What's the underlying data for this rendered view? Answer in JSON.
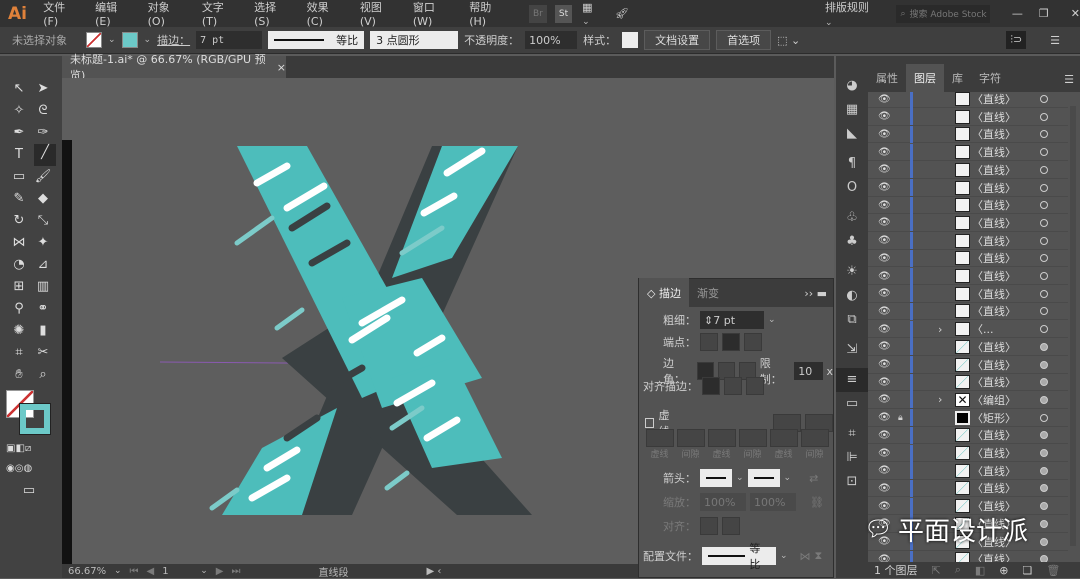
{
  "app": {
    "logo": "Ai",
    "menus": [
      "文件(F)",
      "编辑(E)",
      "对象(O)",
      "文字(T)",
      "选择(S)",
      "效果(C)",
      "视图(V)",
      "窗口(W)",
      "帮助(H)"
    ],
    "bridge": "Br",
    "stock": "St",
    "workspace": "排版规则",
    "search_placeholder": "搜索 Adobe Stock"
  },
  "control": {
    "selection": "未选择对象",
    "stroke_label": "描边：",
    "stroke_weight": "7 pt",
    "profile": "等比",
    "brush": "3 点圆形",
    "opacity_label": "不透明度：",
    "opacity": "100%",
    "style_label": "样式：",
    "doc_setup": "文档设置",
    "preferences": "首选项"
  },
  "document": {
    "tab": "未标题-1.ai* @ 66.67% (RGB/GPU 预览)",
    "close": "×"
  },
  "status": {
    "zoom": "66.67%",
    "artboard": "1",
    "tool": "直线段"
  },
  "layers": {
    "tabs": [
      "属性",
      "图层",
      "库",
      "字符"
    ],
    "active_tab": "图层",
    "footer": "1 个图层",
    "rows": [
      {
        "name": "〈直线〉",
        "t": 0
      },
      {
        "name": "〈直线〉",
        "t": 0
      },
      {
        "name": "〈直线〉",
        "t": 0
      },
      {
        "name": "〈直线〉",
        "t": 0
      },
      {
        "name": "〈直线〉",
        "t": 0
      },
      {
        "name": "〈直线〉",
        "t": 0
      },
      {
        "name": "〈直线〉",
        "t": 0
      },
      {
        "name": "〈直线〉",
        "t": 0
      },
      {
        "name": "〈直线〉",
        "t": 0
      },
      {
        "name": "〈直线〉",
        "t": 0
      },
      {
        "name": "〈直线〉",
        "t": 0
      },
      {
        "name": "〈直线〉",
        "t": 0
      },
      {
        "name": "〈直线〉",
        "t": 0
      },
      {
        "name": "〈...",
        "t": 0,
        "expand": true
      },
      {
        "name": "〈直线〉",
        "t": 1
      },
      {
        "name": "〈直线〉",
        "t": 1
      },
      {
        "name": "〈直线〉",
        "t": 1
      },
      {
        "name": "〈编组〉",
        "t": 1,
        "expand": true
      },
      {
        "name": "〈矩形〉",
        "t": 0,
        "locked": true
      },
      {
        "name": "〈直线〉",
        "t": 1
      },
      {
        "name": "〈直线〉",
        "t": 1
      },
      {
        "name": "〈直线〉",
        "t": 1
      },
      {
        "name": "〈直线〉",
        "t": 1
      },
      {
        "name": "〈直线〉",
        "t": 1
      },
      {
        "name": "〈直线〉",
        "t": 1
      },
      {
        "name": "〈直线〉",
        "t": 1
      },
      {
        "name": "〈直线〉",
        "t": 1
      }
    ]
  },
  "stroke_panel": {
    "tabs": [
      "描边",
      "渐变"
    ],
    "weight_label": "粗细：",
    "weight": "7 pt",
    "cap_label": "端点：",
    "corner_label": "边角：",
    "limit_label": "限制：",
    "limit": "10",
    "limit_unit": "x",
    "align_label": "对齐描边：",
    "dashed_label": "虚线",
    "dash_fields": [
      "虚线",
      "间隙",
      "虚线",
      "间隙",
      "虚线",
      "间隙"
    ],
    "arrow_label": "箭头：",
    "scale_label": "缩放：",
    "scale1": "100%",
    "scale2": "100%",
    "align2_label": "对齐：",
    "profile_label": "配置文件：",
    "profile": "等比"
  },
  "watermark": "平面设计派",
  "colors": {
    "teal": "#4dbdbb",
    "dark": "#3a4042",
    "canvas": "#5e5e5e",
    "accent": "#e0813a"
  }
}
